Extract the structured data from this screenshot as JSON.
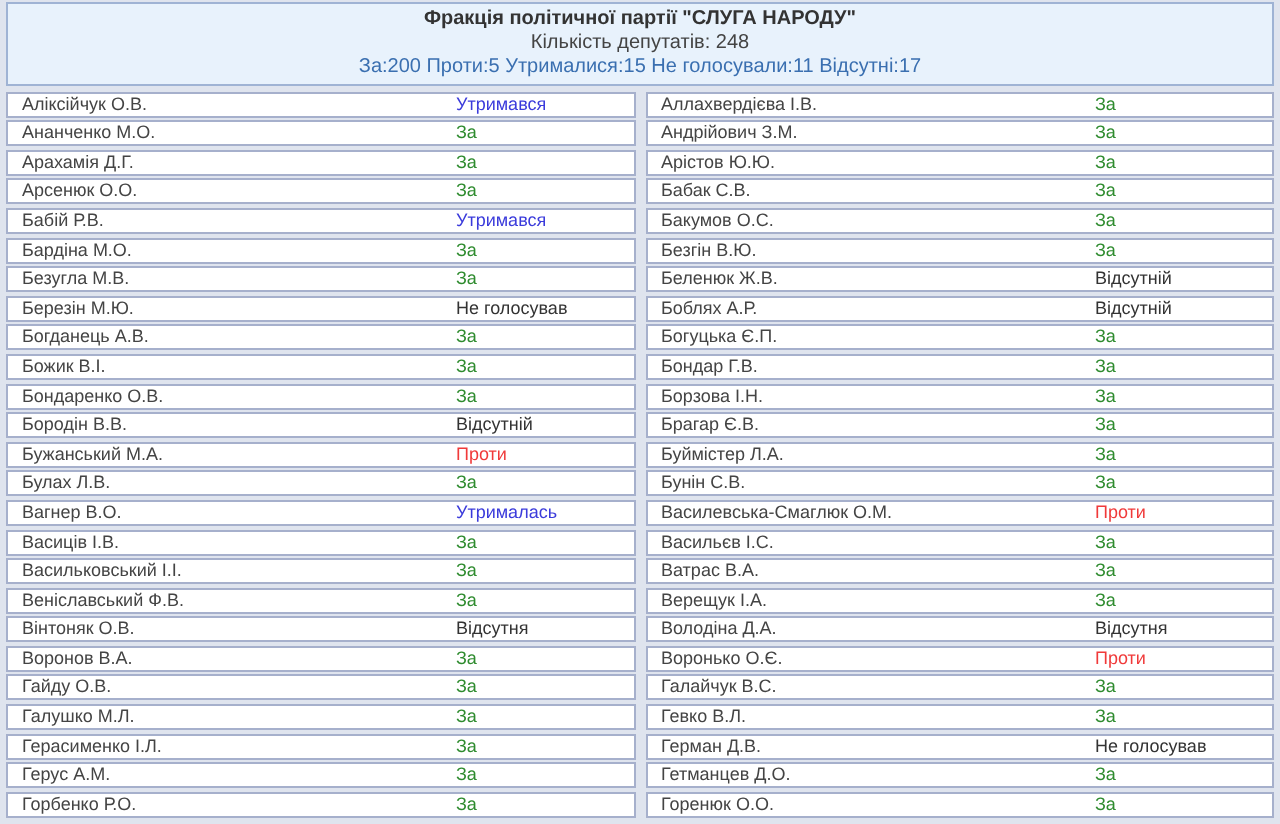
{
  "header": {
    "title": "Фракція політичної партії \"СЛУГА НАРОДУ\"",
    "count": "Кількість депутатів: 248",
    "summary": "За:200 Проти:5 Утрималися:15 Не голосували:11 Відсутні:17"
  },
  "columns": [
    {
      "rows": [
        {
          "name": "Аліксійчук О.В.",
          "vote": "Утримався",
          "kind": "abstain"
        },
        {
          "name": "Ананченко М.О.",
          "vote": "За",
          "kind": "for"
        },
        {
          "name": "Арахамія Д.Г.",
          "vote": "За",
          "kind": "for"
        },
        {
          "name": "Арсенюк О.О.",
          "vote": "За",
          "kind": "for"
        },
        {
          "name": "Бабій Р.В.",
          "vote": "Утримався",
          "kind": "abstain"
        },
        {
          "name": "Бардіна М.О.",
          "vote": "За",
          "kind": "for"
        },
        {
          "name": "Безугла М.В.",
          "vote": "За",
          "kind": "for"
        },
        {
          "name": "Березін М.Ю.",
          "vote": "Не голосував",
          "kind": "none"
        },
        {
          "name": "Богданець А.В.",
          "vote": "За",
          "kind": "for"
        },
        {
          "name": "Божик В.І.",
          "vote": "За",
          "kind": "for"
        },
        {
          "name": "Бондаренко О.В.",
          "vote": "За",
          "kind": "for"
        },
        {
          "name": "Бородін В.В.",
          "vote": "Відсутній",
          "kind": "none"
        },
        {
          "name": "Бужанський М.А.",
          "vote": "Проти",
          "kind": "against"
        },
        {
          "name": "Булах Л.В.",
          "vote": "За",
          "kind": "for"
        },
        {
          "name": "Вагнер В.О.",
          "vote": "Утрималась",
          "kind": "abstain"
        },
        {
          "name": "Васиців І.В.",
          "vote": "За",
          "kind": "for"
        },
        {
          "name": "Васильковський І.І.",
          "vote": "За",
          "kind": "for"
        },
        {
          "name": "Веніславський Ф.В.",
          "vote": "За",
          "kind": "for"
        },
        {
          "name": "Вінтоняк О.В.",
          "vote": "Відсутня",
          "kind": "none"
        },
        {
          "name": "Воронов В.А.",
          "vote": "За",
          "kind": "for"
        },
        {
          "name": "Гайду О.В.",
          "vote": "За",
          "kind": "for"
        },
        {
          "name": "Галушко М.Л.",
          "vote": "За",
          "kind": "for"
        },
        {
          "name": "Герасименко І.Л.",
          "vote": "За",
          "kind": "for"
        },
        {
          "name": "Герус А.М.",
          "vote": "За",
          "kind": "for"
        },
        {
          "name": "Горбенко Р.О.",
          "vote": "За",
          "kind": "for"
        }
      ]
    },
    {
      "rows": [
        {
          "name": "Аллахвердієва І.В.",
          "vote": "За",
          "kind": "for"
        },
        {
          "name": "Андрійович З.М.",
          "vote": "За",
          "kind": "for"
        },
        {
          "name": "Арістов Ю.Ю.",
          "vote": "За",
          "kind": "for"
        },
        {
          "name": "Бабак С.В.",
          "vote": "За",
          "kind": "for"
        },
        {
          "name": "Бакумов О.С.",
          "vote": "За",
          "kind": "for"
        },
        {
          "name": "Безгін В.Ю.",
          "vote": "За",
          "kind": "for"
        },
        {
          "name": "Беленюк Ж.В.",
          "vote": "Відсутній",
          "kind": "none"
        },
        {
          "name": "Боблях А.Р.",
          "vote": "Відсутній",
          "kind": "none"
        },
        {
          "name": "Богуцька Є.П.",
          "vote": "За",
          "kind": "for"
        },
        {
          "name": "Бондар Г.В.",
          "vote": "За",
          "kind": "for"
        },
        {
          "name": "Борзова І.Н.",
          "vote": "За",
          "kind": "for"
        },
        {
          "name": "Брагар Є.В.",
          "vote": "За",
          "kind": "for"
        },
        {
          "name": "Буймістер Л.А.",
          "vote": "За",
          "kind": "for"
        },
        {
          "name": "Бунін С.В.",
          "vote": "За",
          "kind": "for"
        },
        {
          "name": "Василевська-Смаглюк О.М.",
          "vote": "Проти",
          "kind": "against"
        },
        {
          "name": "Васильєв І.С.",
          "vote": "За",
          "kind": "for"
        },
        {
          "name": "Ватрас В.А.",
          "vote": "За",
          "kind": "for"
        },
        {
          "name": "Верещук І.А.",
          "vote": "За",
          "kind": "for"
        },
        {
          "name": "Володіна Д.А.",
          "vote": "Відсутня",
          "kind": "none"
        },
        {
          "name": "Воронько О.Є.",
          "vote": "Проти",
          "kind": "against"
        },
        {
          "name": "Галайчук В.С.",
          "vote": "За",
          "kind": "for"
        },
        {
          "name": "Гевко В.Л.",
          "vote": "За",
          "kind": "for"
        },
        {
          "name": "Герман Д.В.",
          "vote": "Не голосував",
          "kind": "none"
        },
        {
          "name": "Гетманцев Д.О.",
          "vote": "За",
          "kind": "for"
        },
        {
          "name": "Горенюк О.О.",
          "vote": "За",
          "kind": "for"
        }
      ]
    }
  ]
}
